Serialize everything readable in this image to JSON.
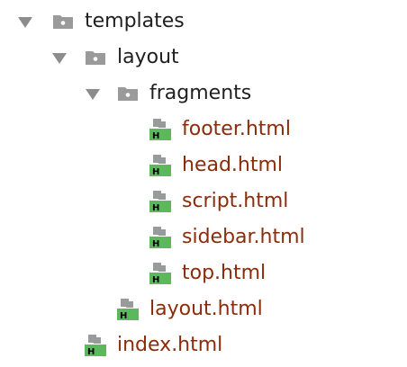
{
  "colors": {
    "folder_text": "#1f1f1f",
    "file_text": "#8b2c0a",
    "html_badge": "#5cb85c",
    "icon_gray": "#9a9a9a",
    "arrow": "#8c8c8c"
  },
  "tree": {
    "templates": {
      "label": "templates",
      "icon": "folder-icon",
      "expanded": true
    },
    "layout": {
      "label": "layout",
      "icon": "folder-icon",
      "expanded": true
    },
    "fragments": {
      "label": "fragments",
      "icon": "folder-icon",
      "expanded": true
    },
    "badge_letter": "H",
    "files": {
      "footer": "footer.html",
      "head": "head.html",
      "script": "script.html",
      "sidebar": "sidebar.html",
      "top": "top.html",
      "layout": "layout.html",
      "index": "index.html"
    }
  }
}
